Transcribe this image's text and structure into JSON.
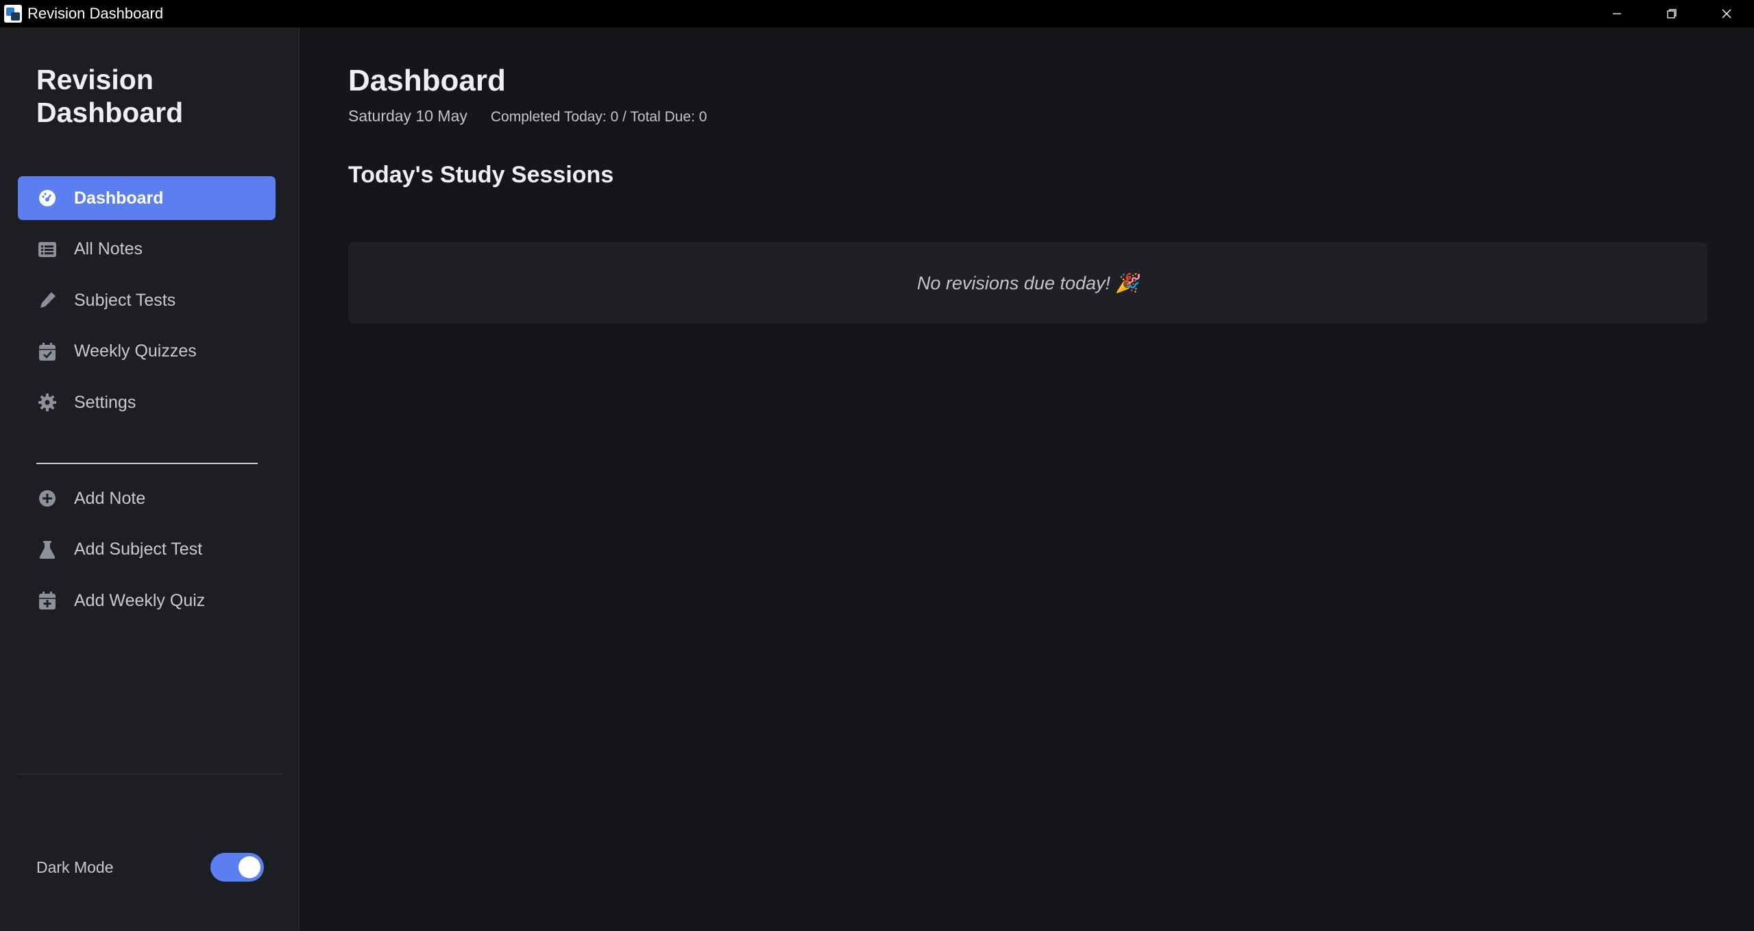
{
  "window": {
    "title": "Revision Dashboard",
    "icon": "app-icon"
  },
  "sidebar": {
    "brand": "Revision Dashboard",
    "nav": [
      {
        "label": "Dashboard",
        "icon": "gauge-icon",
        "active": true
      },
      {
        "label": "All Notes",
        "icon": "list-icon",
        "active": false
      },
      {
        "label": "Subject Tests",
        "icon": "pen-icon",
        "active": false
      },
      {
        "label": "Weekly Quizzes",
        "icon": "calendar-check-icon",
        "active": false
      },
      {
        "label": "Settings",
        "icon": "gear-icon",
        "active": false
      }
    ],
    "actions": [
      {
        "label": "Add Note",
        "icon": "plus-circle-icon"
      },
      {
        "label": "Add Subject Test",
        "icon": "flask-icon"
      },
      {
        "label": "Add Weekly Quiz",
        "icon": "calendar-plus-icon"
      }
    ],
    "dark_mode": {
      "label": "Dark Mode",
      "on": true
    }
  },
  "main": {
    "title": "Dashboard",
    "date": "Saturday 10 May",
    "stats": "Completed Today: 0 / Total Due: 0",
    "section_title": "Today's Study Sessions",
    "empty_message": "No revisions due today! 🎉"
  },
  "colors": {
    "accent": "#5b7ff0",
    "background": "#15161b",
    "sidebar": "#1d1e23",
    "card": "#1f2026"
  }
}
